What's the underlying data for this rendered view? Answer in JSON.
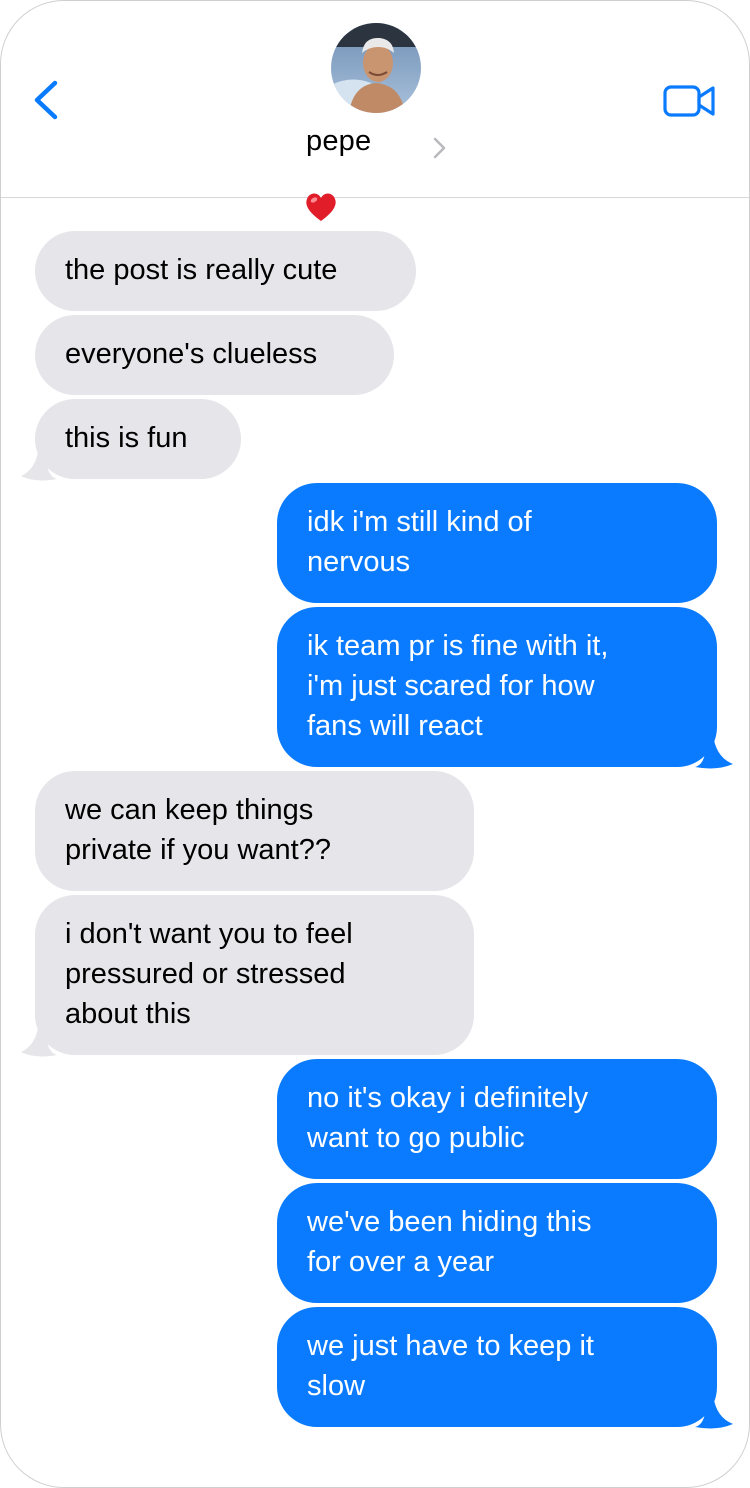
{
  "contact": {
    "name": "pepe",
    "reaction": "❤️"
  },
  "colors": {
    "sent_bubble": "#0a7bff",
    "received_bubble": "#e5e5ea",
    "accent": "#0a7bff"
  },
  "icons": {
    "back": "chevron-left-icon",
    "details": "chevron-right-icon",
    "video": "video-camera-icon"
  },
  "messages": [
    {
      "from": "them",
      "text": "the post is really cute"
    },
    {
      "from": "them",
      "text": "everyone's clueless"
    },
    {
      "from": "them",
      "text": "this is fun"
    },
    {
      "from": "me",
      "text": "idk i'm still kind of\nnervous"
    },
    {
      "from": "me",
      "text": "ik team pr is fine with it,\ni'm just scared for how\nfans will react"
    },
    {
      "from": "them",
      "text": "we can keep things\nprivate if you want??"
    },
    {
      "from": "them",
      "text": "i don't want you to feel\npressured or stressed\nabout this"
    },
    {
      "from": "me",
      "text": "no it's okay i definitely\nwant to go public"
    },
    {
      "from": "me",
      "text": "we've been hiding this\nfor over a year"
    },
    {
      "from": "me",
      "text": "we just have to keep it\nslow"
    }
  ]
}
